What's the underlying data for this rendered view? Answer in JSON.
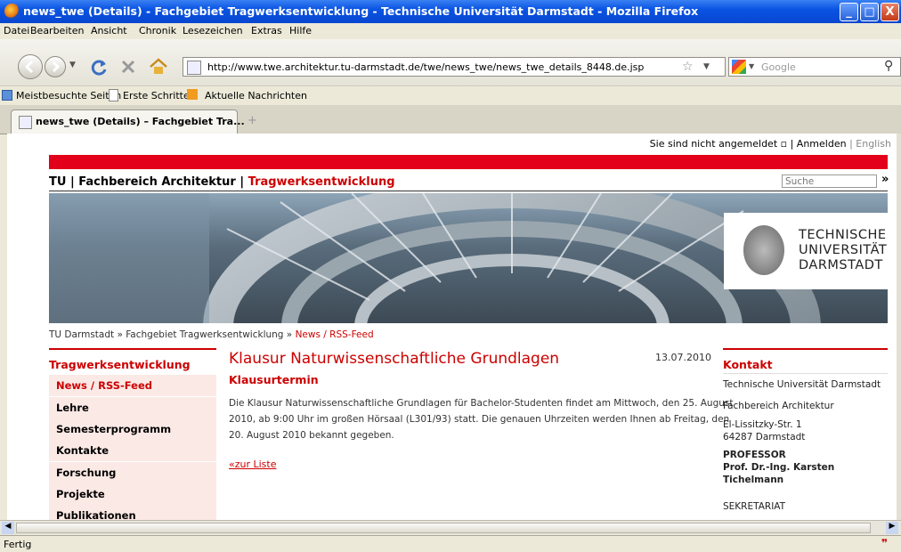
{
  "window": {
    "title": "news_twe (Details) - Fachgebiet Tragwerksentwicklung - Technische Universität Darmstadt - Mozilla Firefox",
    "controls": [
      "_",
      "□",
      "X"
    ]
  },
  "menu": [
    "Datei",
    "Bearbeiten",
    "Ansicht",
    "Chronik",
    "Lesezeichen",
    "Extras",
    "Hilfe"
  ],
  "nav": {
    "url": "http://www.twe.architektur.tu-darmstadt.de/twe/news_twe/news_twe_details_8448.de.jsp",
    "search_placeholder": "Google"
  },
  "bookmarks": [
    "Meistbesuchte Seiten",
    "Erste Schritte",
    "Aktuelle Nachrichten"
  ],
  "tab": {
    "title": "news_twe (Details) – Fachgebiet Tra...",
    "new_tab": "+"
  },
  "page": {
    "login_text": "Sie sind nicht angemeldet",
    "login_link": "Anmelden",
    "lang_link": "English",
    "header_tu": "TU | Fachbereich Architektur |",
    "header_twe": "Tragwerksentwicklung",
    "search_placeholder": "Suche",
    "search_go": "»",
    "logo": [
      "TECHNISCHE",
      "UNIVERSITÄT",
      "DARMSTADT"
    ],
    "breadcrumb": {
      "part1": "TU Darmstadt » Fachgebiet Tragwerksentwicklung »",
      "current": "News / RSS-Feed"
    },
    "sidebar": {
      "heading": "Tragwerksentwicklung",
      "items": [
        "News / RSS-Feed",
        "Lehre",
        "Semesterprogramm",
        "Kontakte",
        "Forschung",
        "Projekte",
        "Publikationen"
      ]
    },
    "article": {
      "title": "Klausur Naturwissenschaftliche Grundlagen",
      "date": "13.07.2010",
      "subtitle": "Klausurtermin",
      "body_lines": [
        "Die Klausur Naturwissenschaftliche Grundlagen für Bachelor-Studenten findet am Mittwoch, den 25. August",
        "2010, ab 9:00 Uhr im großen Hörsaal (L301/93) statt. Die genauen Uhrzeiten werden Ihnen ab Freitag, den",
        "20. August 2010 bekannt gegeben."
      ],
      "back_link": "«zur Liste"
    },
    "contact": {
      "heading": "Kontakt",
      "org": "Technische Universität Darmstadt",
      "dept": "Fachbereich Architektur",
      "street": "El-Lissitzky-Str. 1",
      "city": "64287 Darmstadt",
      "role1": "PROFESSOR",
      "name1": "Prof. Dr.-Ing. Karsten",
      "name2": "Tichelmann",
      "role2": "SEKRETARIAT"
    }
  },
  "status": "Fertig",
  "colors": {
    "accent": "#cc0000",
    "sidebar_bg": "#fbe9e6",
    "titlebar": "#0a54e3"
  }
}
